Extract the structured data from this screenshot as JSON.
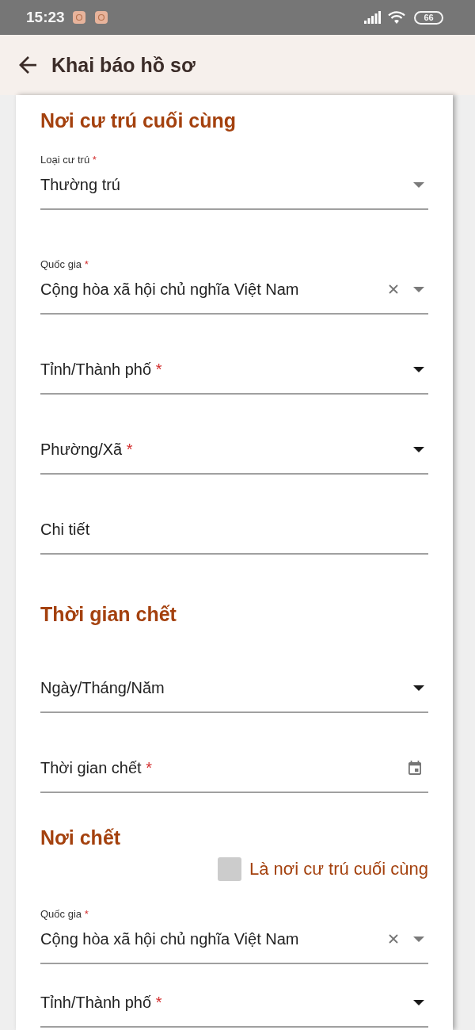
{
  "status_bar": {
    "time": "15:23",
    "battery": "66"
  },
  "header": {
    "title": "Khai báo hồ sơ"
  },
  "sections": [
    {
      "title": "Nơi cư trú cuối cùng",
      "fields": [
        {
          "kind": "select",
          "label": "Loại cư trú",
          "required_mark": "*",
          "value": "Thường trú",
          "clearable": false
        },
        {
          "kind": "select",
          "label": "Quốc gia",
          "required_mark": "*",
          "value": "Cộng hòa xã hội chủ nghĩa Việt Nam",
          "clearable": true
        },
        {
          "kind": "select",
          "label": "Tỉnh/Thành phố",
          "required_mark": "*",
          "clearable": false
        },
        {
          "kind": "select",
          "label": "Phường/Xã",
          "required_mark": "*",
          "clearable": false
        },
        {
          "kind": "text",
          "label": "Chi tiết"
        }
      ]
    },
    {
      "title": "Thời gian chết",
      "fields": [
        {
          "kind": "select",
          "label": "Ngày/Tháng/Năm",
          "clearable": false
        },
        {
          "kind": "date",
          "label": "Thời gian chết",
          "required_mark": "*"
        }
      ]
    },
    {
      "title": "Nơi chết",
      "fields": [
        {
          "kind": "checkbox",
          "label": "Là nơi cư trú cuối cùng",
          "checked": false
        },
        {
          "kind": "select",
          "label": "Quốc gia",
          "required_mark": "*",
          "value": "Cộng hòa xã hội chủ nghĩa Việt Nam",
          "clearable": true
        },
        {
          "kind": "select",
          "label": "Tỉnh/Thành phố",
          "required_mark": "*",
          "clearable": false
        }
      ]
    }
  ]
}
